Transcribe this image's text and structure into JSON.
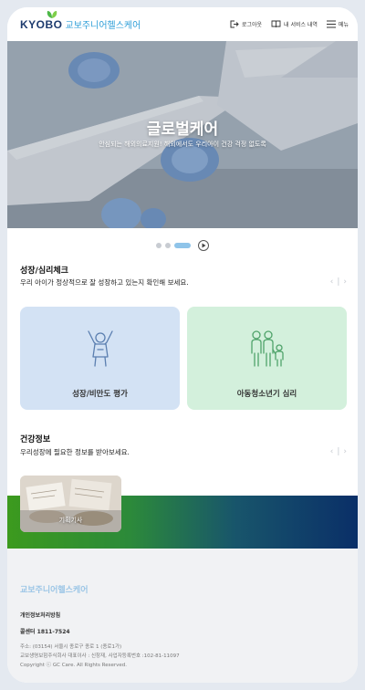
{
  "header": {
    "logo_en": "KYOBO",
    "logo_ko": "교보주니어헬스케어",
    "logout": "로그아웃",
    "my_services": "내 서비스 내역",
    "menu": "메뉴"
  },
  "hero": {
    "title": "글로벌케어",
    "subtitle": "안심되는 해외의료지원! 해외에서도 우리아이 건강 걱정 없도록"
  },
  "growth": {
    "title": "성장/심리체크",
    "subtitle": "우리 아이가 정상적으로 잘 성장하고 있는지 확인해 보세요.",
    "cards": [
      {
        "label": "성장/비만도 평가",
        "icon": "child-cheer-icon"
      },
      {
        "label": "아동청소년기 심리",
        "icon": "family-icon"
      }
    ]
  },
  "health": {
    "title": "건강정보",
    "subtitle": "우리성장에 필요한 정보를 받아보세요.",
    "thumb_label": "기획기사"
  },
  "footer": {
    "brand": "교보주니어헬스케어",
    "privacy": "개인정보처리방침",
    "phone": "콜센터 1811-7524",
    "address": "주소: (03154) 서울시 종로구 종로 1 (종로1가)",
    "company": "교보생명보험주식회사 대표이사 : 신창재, 사업자등록번호 :102-81-11097",
    "copyright": "Copyright ⓒ GC Care. All Rights Reserved."
  },
  "colors": {
    "brand_navy": "#1d3b6e",
    "brand_blue": "#2f9fd8",
    "card_blue": "#d3e2f4",
    "card_green": "#d3f0dc"
  }
}
